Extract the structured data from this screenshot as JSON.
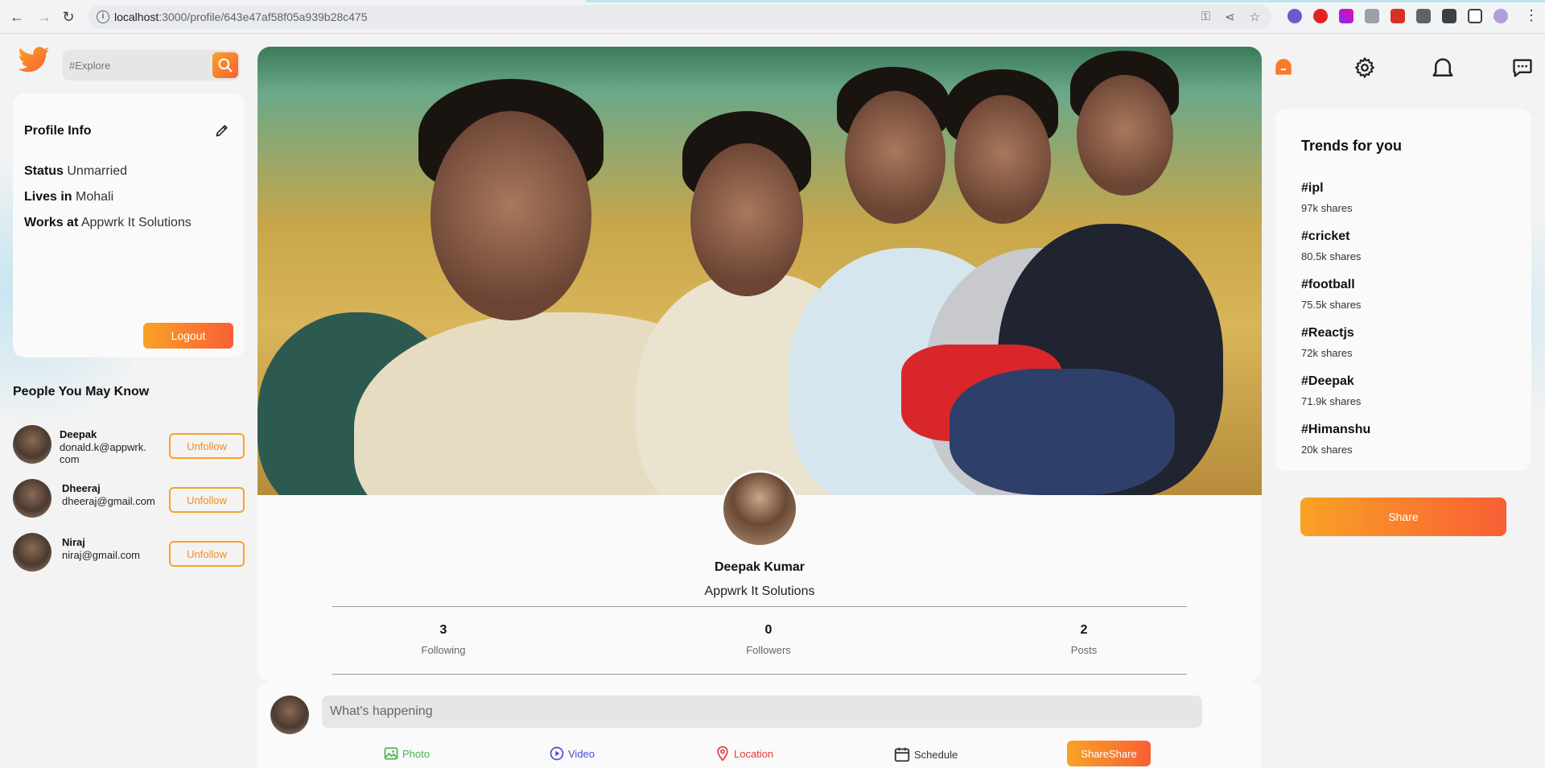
{
  "browser": {
    "url_host": "localhost",
    "url_path": ":3000/profile/643e47af58f05a939b28c475"
  },
  "search": {
    "placeholder": "#Explore"
  },
  "profile_info": {
    "title": "Profile Info",
    "status_label": "Status",
    "status_value": "Unmarried",
    "lives_label": "Lives in",
    "lives_value": "Mohali",
    "works_label": "Works at",
    "works_value": "Appwrk It Solutions",
    "logout_label": "Logout"
  },
  "people_you_may_know": {
    "title": "People You May Know",
    "people": [
      {
        "name": "Deepak",
        "email": "donald.k@appwrk.com",
        "action": "Unfollow"
      },
      {
        "name": "Dheeraj",
        "email": "dheeraj@gmail.com",
        "action": "Unfollow"
      },
      {
        "name": "Niraj",
        "email": "niraj@gmail.com",
        "action": "Unfollow"
      }
    ]
  },
  "profile": {
    "name": "Deepak Kumar",
    "work": "Appwrk It Solutions",
    "stats": [
      {
        "value": "3",
        "label": "Following"
      },
      {
        "value": "0",
        "label": "Followers"
      },
      {
        "value": "2",
        "label": "Posts"
      }
    ]
  },
  "post_share": {
    "placeholder": "What's happening",
    "options": {
      "photo": "Photo",
      "video": "Video",
      "location": "Location",
      "schedule": "Schedule"
    },
    "share_label": "ShareShare"
  },
  "trends": {
    "title": "Trends for you",
    "items": [
      {
        "tag": "#ipl",
        "shares": "97k shares"
      },
      {
        "tag": "#cricket",
        "shares": "80.5k shares"
      },
      {
        "tag": "#football",
        "shares": "75.5k shares"
      },
      {
        "tag": "#Reactjs",
        "shares": "72k shares"
      },
      {
        "tag": "#Deepak",
        "shares": "71.9k shares"
      },
      {
        "tag": "#Himanshu",
        "shares": "20k shares"
      }
    ],
    "share_label": "Share"
  },
  "colors": {
    "accent_start": "#f9a225",
    "accent_end": "#f95f35",
    "photo": "#4caf50",
    "video": "#4a4ad0",
    "location": "#e53935",
    "schedule": "#333333"
  }
}
